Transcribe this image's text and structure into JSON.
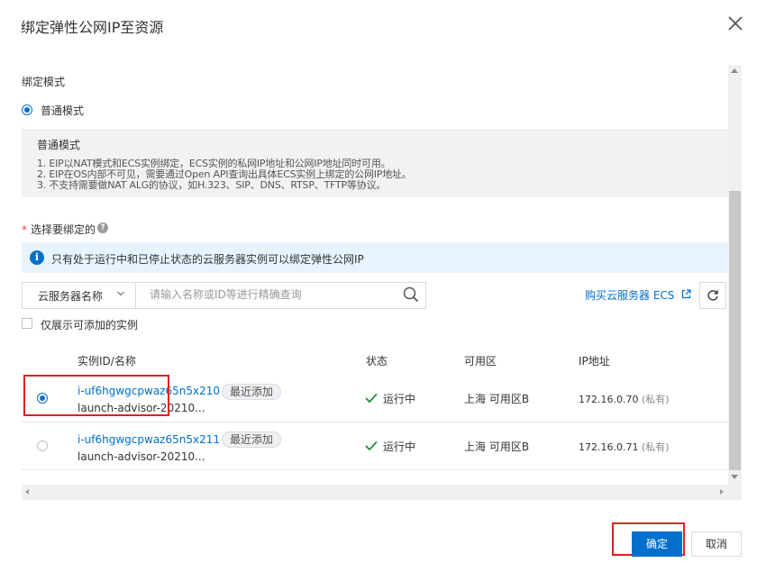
{
  "dialog": {
    "title": "绑定弹性公网IP至资源",
    "close_icon": "close-icon"
  },
  "bind_mode": {
    "label": "绑定模式",
    "option": "普通模式",
    "selected": true
  },
  "description": {
    "title": "普通模式",
    "lines": [
      "1. EIP以NAT模式和ECS实例绑定，ECS实例的私网IP地址和公网IP地址同时可用。",
      "2. EIP在OS内部不可见，需要通过Open API查询出具体ECS实例上绑定的公网IP地址。",
      "3. 不支持需要做NAT ALG的协议，如H.323、SIP、DNS、RTSP、TFTP等协议。"
    ]
  },
  "select_section": {
    "required_mark": "*",
    "label": "选择要绑定的",
    "help_icon": "question-circle-icon"
  },
  "info": {
    "icon": "info-icon",
    "text": "只有处于运行中和已停止状态的云服务器实例可以绑定弹性公网IP"
  },
  "search": {
    "type_label": "云服务器名称",
    "placeholder": "请输入名称或ID等进行精确查询",
    "value": ""
  },
  "buy_link": "购买云服务器 ECS",
  "only_addable": {
    "label": "仅展示可添加的实例",
    "checked": false
  },
  "table": {
    "headers": [
      "实例ID/名称",
      "状态",
      "可用区",
      "IP地址"
    ],
    "rows": [
      {
        "selected": true,
        "id": "i-uf6hgwgcpwaz65n5x210",
        "name": "launch-advisor-20210...",
        "tag": "最近添加",
        "status": "运行中",
        "zone": "上海 可用区B",
        "ip": "172.16.0.70",
        "ip_note": "(私有)"
      },
      {
        "selected": false,
        "id": "i-uf6hgwgcpwaz65n5x211",
        "name": "launch-advisor-20210...",
        "tag": "最近添加",
        "status": "运行中",
        "zone": "上海 可用区B",
        "ip": "172.16.0.71",
        "ip_note": "(私有)"
      }
    ]
  },
  "footer": {
    "ok": "确定",
    "cancel": "取消"
  },
  "colors": {
    "primary": "#0070cc",
    "success": "#1e8e3e",
    "highlight": "#e02020",
    "info_bg": "#e7f4fd"
  }
}
